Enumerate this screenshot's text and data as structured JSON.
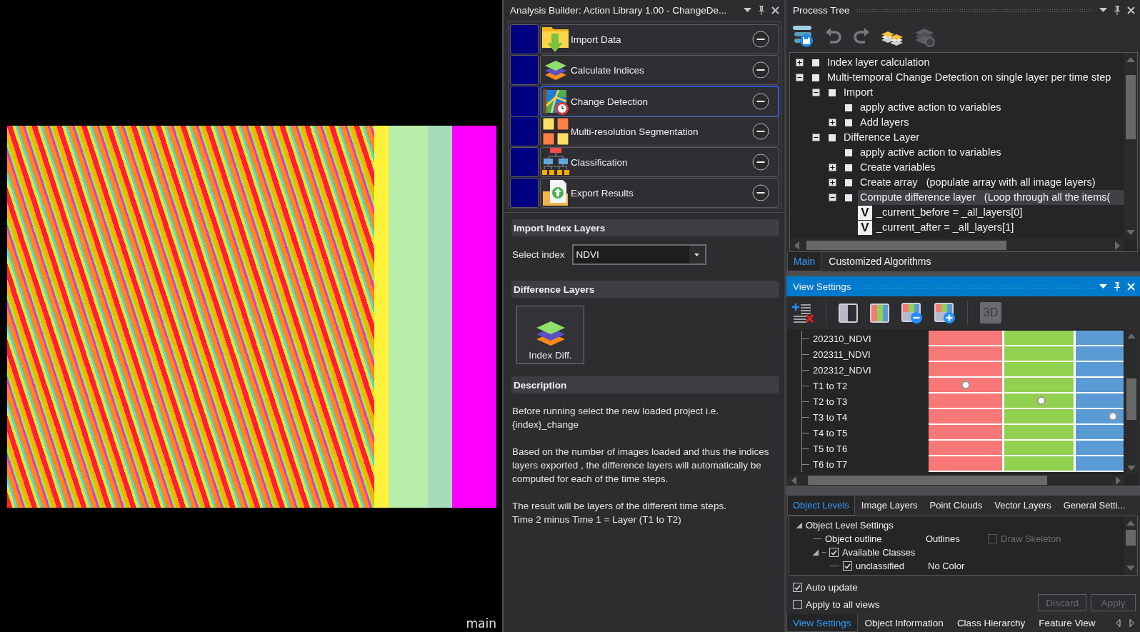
{
  "viewer": {
    "label": "main"
  },
  "action_library": {
    "title": "Analysis Builder: Action Library 1.00 - ChangeDe...",
    "active": false,
    "actions": [
      {
        "kind": "import",
        "label": "Import Data",
        "selected": false
      },
      {
        "kind": "indices",
        "label": "Calculate Indices",
        "selected": false
      },
      {
        "kind": "change",
        "label": "Change Detection",
        "selected": true
      },
      {
        "kind": "segmentation",
        "label": "Multi-resolution Segmentation",
        "selected": false
      },
      {
        "kind": "classification",
        "label": "Classification",
        "selected": false
      },
      {
        "kind": "export",
        "label": "Export Results",
        "selected": false
      }
    ]
  },
  "import_index_layers": {
    "title": "Import Index Layers",
    "select_label": "Select index",
    "select_value": "NDVI"
  },
  "difference_layers": {
    "title": "Difference Layers",
    "button": "Index Diff."
  },
  "description": {
    "title": "Description",
    "paragraphs": [
      [
        "Before running select the new loaded project i.e.",
        "{index}_change"
      ],
      [
        "Based on the number of images loaded and thus the indices",
        "layers exported , the difference layers will automatically be",
        "computed for each of the time steps."
      ],
      [
        "The result will be layers of the different time steps.",
        "Time 2 minus Time 1 = Layer (T1 to T2)"
      ]
    ]
  },
  "process_tree": {
    "title": "Process Tree",
    "active": false,
    "items": [
      {
        "kind": "node",
        "label": "Index layer calculation",
        "expanded": false,
        "selected": false
      },
      {
        "kind": "node",
        "label": "Multi-temporal Change Detection on single layer per time step",
        "expanded": true,
        "selected": false,
        "children": [
          {
            "kind": "node",
            "label": "Import",
            "expanded": true,
            "selected": false,
            "children": [
              {
                "kind": "leaf",
                "label": "apply active action to variables",
                "selected": false
              },
              {
                "kind": "node",
                "label": "Add layers",
                "expanded": false,
                "selected": false
              }
            ]
          },
          {
            "kind": "node",
            "label": "Difference Layer",
            "expanded": true,
            "selected": false,
            "children": [
              {
                "kind": "leaf",
                "label": "apply active action to variables",
                "selected": false
              },
              {
                "kind": "node",
                "label": "Create variables",
                "expanded": false,
                "selected": false
              },
              {
                "kind": "node",
                "label": "Create array   (populate array with all image layers)",
                "expanded": false,
                "selected": false
              },
              {
                "kind": "node",
                "label": "Compute difference layer   (Loop through all the items(",
                "expanded": true,
                "selected": true,
                "children": [
                  {
                    "kind": "variable",
                    "badge": "V",
                    "label": "_current_before = _all_layers[0]",
                    "selected": false
                  },
                  {
                    "kind": "variable",
                    "badge": "V",
                    "label": "_current_after = _all_layers[1]",
                    "selected": false
                  }
                ]
              }
            ]
          }
        ]
      }
    ],
    "tabs": [
      {
        "label": "Main",
        "selected": true
      },
      {
        "label": "Customized Algorithms",
        "selected": false
      }
    ]
  },
  "view_settings": {
    "title": "View Settings",
    "active": true,
    "view_3d": "3D",
    "layers": [
      {
        "label": "202310_NDVI",
        "channels": [
          {
            "selected": false
          },
          {
            "selected": false
          },
          {
            "selected": false
          }
        ]
      },
      {
        "label": "202311_NDVI",
        "channels": [
          {
            "selected": false
          },
          {
            "selected": false
          },
          {
            "selected": false
          }
        ]
      },
      {
        "label": "202312_NDVI",
        "channels": [
          {
            "selected": false
          },
          {
            "selected": false
          },
          {
            "selected": false
          }
        ]
      },
      {
        "label": "T1 to T2",
        "channels": [
          {
            "selected": true
          },
          {
            "selected": false
          },
          {
            "selected": false
          }
        ]
      },
      {
        "label": "T2 to T3",
        "channels": [
          {
            "selected": false
          },
          {
            "selected": true
          },
          {
            "selected": false
          }
        ]
      },
      {
        "label": "T3 to T4",
        "channels": [
          {
            "selected": false
          },
          {
            "selected": false
          },
          {
            "selected": true
          }
        ]
      },
      {
        "label": "T4 to T5",
        "channels": [
          {
            "selected": false
          },
          {
            "selected": false
          },
          {
            "selected": false
          }
        ]
      },
      {
        "label": "T5 to T6",
        "channels": [
          {
            "selected": false
          },
          {
            "selected": false
          },
          {
            "selected": false
          }
        ]
      },
      {
        "label": "T6 to T7",
        "channels": [
          {
            "selected": false
          },
          {
            "selected": false
          },
          {
            "selected": false
          }
        ]
      }
    ],
    "tabs": [
      {
        "label": "Object Levels",
        "selected": true
      },
      {
        "label": "Image Layers",
        "selected": false
      },
      {
        "label": "Point Clouds",
        "selected": false
      },
      {
        "label": "Vector Layers",
        "selected": false
      },
      {
        "label": "General Setti...",
        "selected": false
      }
    ],
    "object_tree": {
      "label": "Object Level Settings",
      "expanded": true,
      "children": [
        {
          "kind": "setting",
          "label": "Object outline",
          "value": "Outlines",
          "option": {
            "label": "Draw Skeleton",
            "checked": false,
            "disabled": true
          }
        },
        {
          "kind": "class",
          "label": "Available Classes",
          "checked": true,
          "expanded": true,
          "children": [
            {
              "kind": "class",
              "label": "unclassified",
              "checked": true,
              "value": "No Color"
            }
          ]
        }
      ]
    },
    "auto_update": {
      "label": "Auto update",
      "checked": true
    },
    "apply_all_views": {
      "label": "Apply to all views",
      "checked": false
    },
    "buttons": [
      {
        "label": "Discard",
        "disabled": true
      },
      {
        "label": "Apply",
        "disabled": true
      }
    ]
  },
  "bottom_tabs": [
    {
      "label": "View Settings",
      "selected": true
    },
    {
      "label": "Object Information",
      "selected": false
    },
    {
      "label": "Class Hierarchy",
      "selected": false
    },
    {
      "label": "Feature View",
      "selected": false
    }
  ]
}
